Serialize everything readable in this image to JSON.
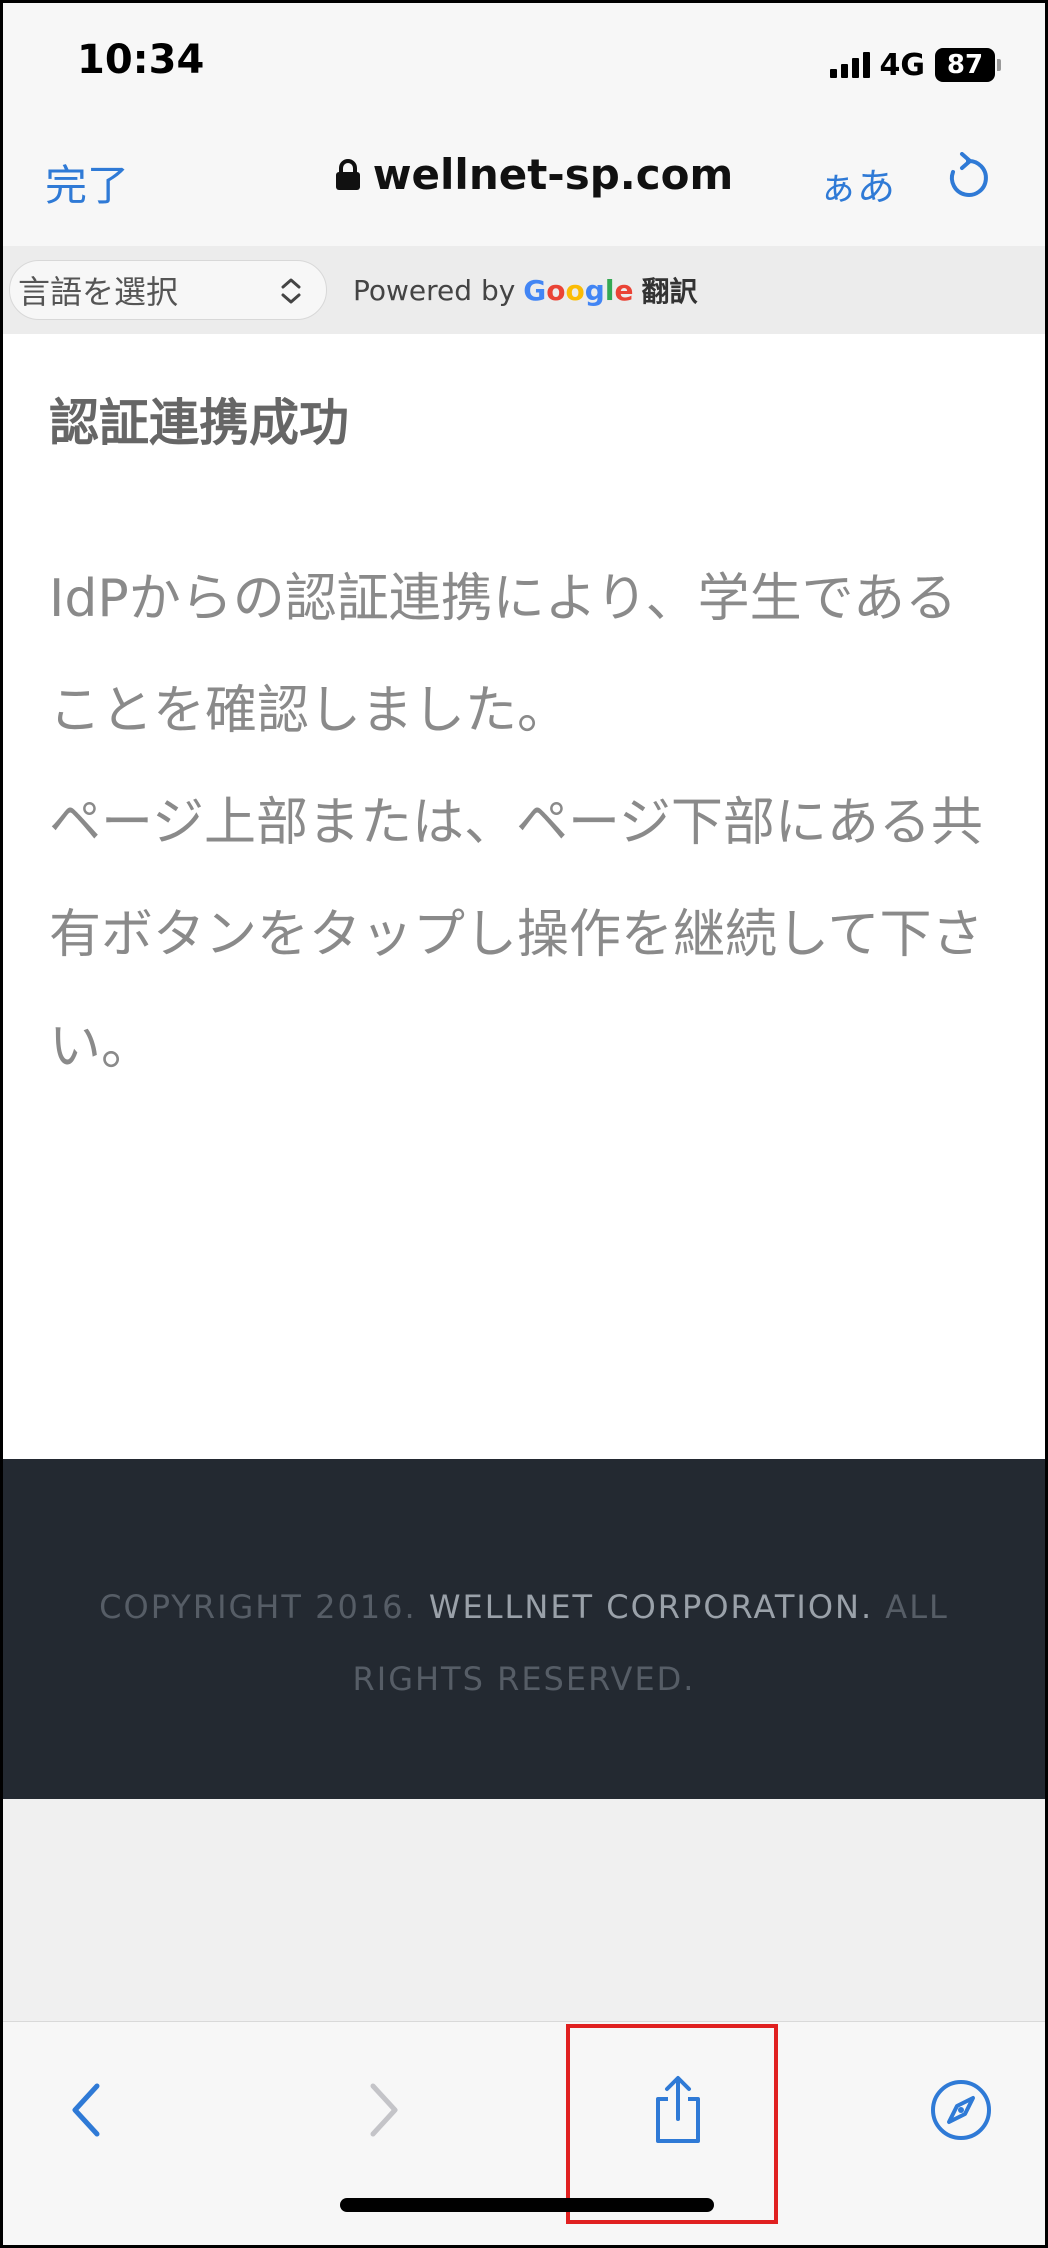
{
  "status_bar": {
    "time": "10:34",
    "network": "4G",
    "battery": "87"
  },
  "nav": {
    "done_label": "完了",
    "url": "wellnet-sp.com",
    "text_size_label": "ぁあ"
  },
  "translate_bar": {
    "select_label": "言語を選択",
    "powered_by": "Powered by",
    "google_letters": [
      "G",
      "o",
      "o",
      "g",
      "l",
      "e"
    ],
    "translate_word": "翻訳"
  },
  "content": {
    "heading": "認証連携成功",
    "paragraphs": [
      "IdPからの認証連携により、学生であることを確認しました。",
      "ページ上部または、ページ下部にある共有ボタンをタップし操作を継続して下さい。"
    ]
  },
  "footer": {
    "copyright_prefix": "COPYRIGHT 2016.",
    "copyright_brand": "WELLNET CORPORATION.",
    "copyright_suffix": "ALL RIGHTS RESERVED."
  },
  "colors": {
    "accent": "#2f7ad6",
    "footer_bg": "#232931",
    "highlight": "#e02020"
  },
  "icons": [
    "lock-icon",
    "reload-icon",
    "select-arrows-icon",
    "back-chevron-icon",
    "forward-chevron-icon",
    "share-icon",
    "compass-icon"
  ]
}
